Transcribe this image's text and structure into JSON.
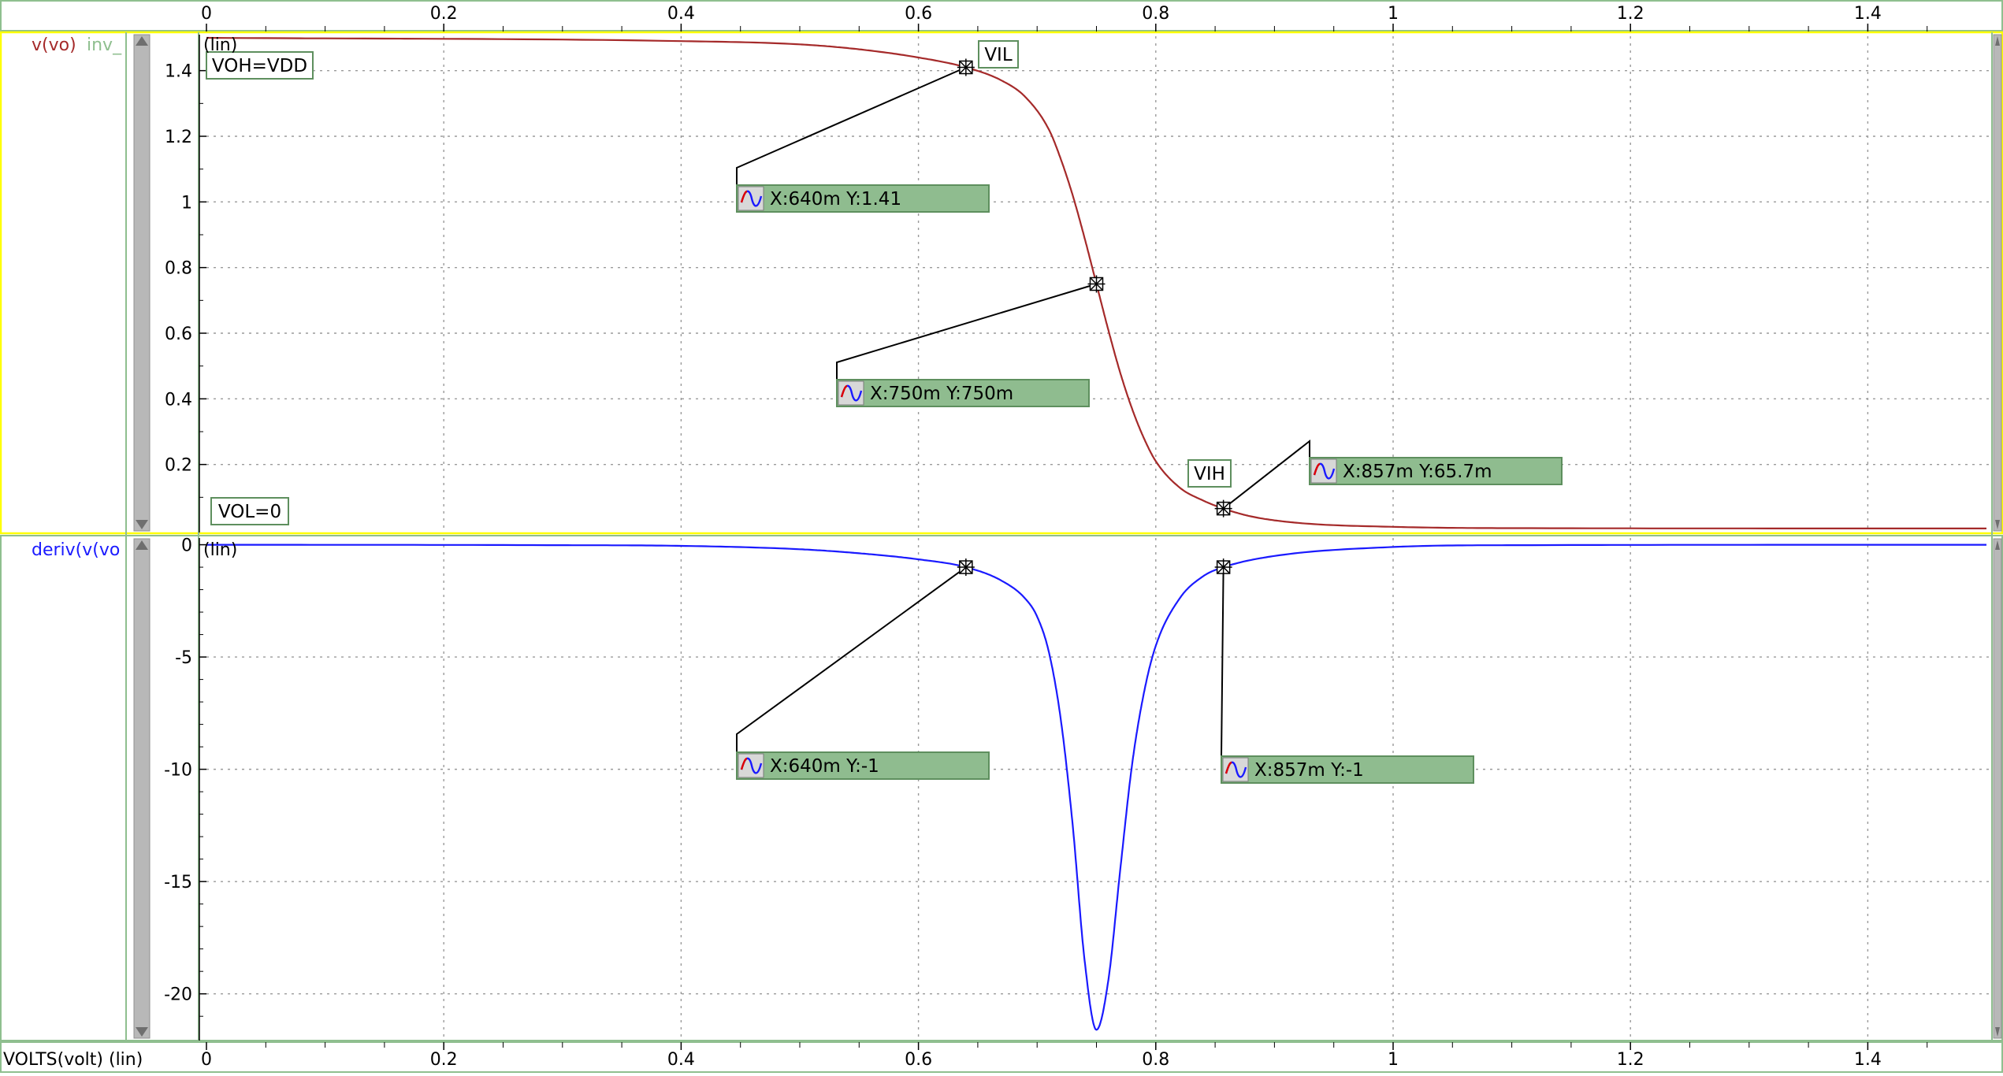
{
  "colors": {
    "trace_top": "#a52a2a",
    "trace_bottom": "#1a1aff",
    "panel_highlight": "#ffff00",
    "frame_green": "#8fbf8f",
    "label_fill": "#8fbc8f",
    "grid": "#9a9a9a",
    "scrollbar": "#b8b8b8"
  },
  "x_axis": {
    "label": "VOLTS(volt) (lin)",
    "ticks": [
      "0",
      "0.2",
      "0.4",
      "0.6",
      "0.8",
      "1",
      "1.2",
      "1.4"
    ],
    "xlim": [
      0,
      1.5
    ]
  },
  "chart_data": [
    {
      "type": "line",
      "panel": "top",
      "scale": "(lin)",
      "series": [
        {
          "name": "v(vo)",
          "x": [
            0,
            0.4,
            0.5,
            0.55,
            0.6,
            0.64,
            0.67,
            0.69,
            0.71,
            0.72,
            0.73,
            0.74,
            0.75,
            0.76,
            0.77,
            0.78,
            0.79,
            0.8,
            0.82,
            0.84,
            0.857,
            0.88,
            0.92,
            1.0,
            1.1,
            1.5
          ],
          "y": [
            1.5,
            1.49,
            1.48,
            1.465,
            1.44,
            1.41,
            1.37,
            1.32,
            1.22,
            1.13,
            1.02,
            0.89,
            0.75,
            0.61,
            0.48,
            0.37,
            0.28,
            0.21,
            0.13,
            0.09,
            0.0657,
            0.042,
            0.022,
            0.01,
            0.006,
            0.005
          ]
        },
        {
          "name": "inv_",
          "x": [],
          "y": []
        }
      ],
      "ylim": [
        0,
        1.5
      ],
      "ytick_labels": [
        "0.2",
        "0.4",
        "0.6",
        "0.8",
        "1",
        "1.2",
        "1.4"
      ],
      "annotations": [
        {
          "text": "VOH=VDD"
        },
        {
          "text": "VOL=0"
        },
        {
          "text": "VIL"
        },
        {
          "text": "VIH"
        }
      ],
      "markers": [
        {
          "x": 0.64,
          "y": 1.41,
          "label": "X:640m Y:1.41"
        },
        {
          "x": 0.75,
          "y": 0.75,
          "label": "X:750m Y:750m"
        },
        {
          "x": 0.857,
          "y": 0.0657,
          "label": "X:857m Y:65.7m"
        }
      ]
    },
    {
      "type": "line",
      "panel": "bottom",
      "scale": "(lin)",
      "series": [
        {
          "name": "deriv(v(vo",
          "x": [
            0,
            0.3,
            0.4,
            0.5,
            0.55,
            0.6,
            0.64,
            0.67,
            0.69,
            0.7,
            0.71,
            0.72,
            0.73,
            0.74,
            0.75,
            0.76,
            0.77,
            0.78,
            0.79,
            0.8,
            0.82,
            0.84,
            0.857,
            0.9,
            1.0,
            1.1,
            1.5
          ],
          "y": [
            0,
            -0.02,
            -0.05,
            -0.2,
            -0.38,
            -0.65,
            -1,
            -1.6,
            -2.4,
            -3.2,
            -4.8,
            -7.8,
            -12.5,
            -18.5,
            -21.6,
            -19.4,
            -14.5,
            -9.8,
            -6.6,
            -4.5,
            -2.4,
            -1.4,
            -1,
            -0.5,
            -0.1,
            -0.02,
            0
          ]
        }
      ],
      "ylim": [
        -21.8,
        0.3
      ],
      "ytick_labels": [
        "0",
        "-5",
        "-10",
        "-15",
        "-20"
      ],
      "markers": [
        {
          "x": 0.64,
          "y": -1,
          "label": "X:640m Y:-1"
        },
        {
          "x": 0.857,
          "y": -1,
          "label": "X:857m Y:-1"
        }
      ]
    }
  ]
}
